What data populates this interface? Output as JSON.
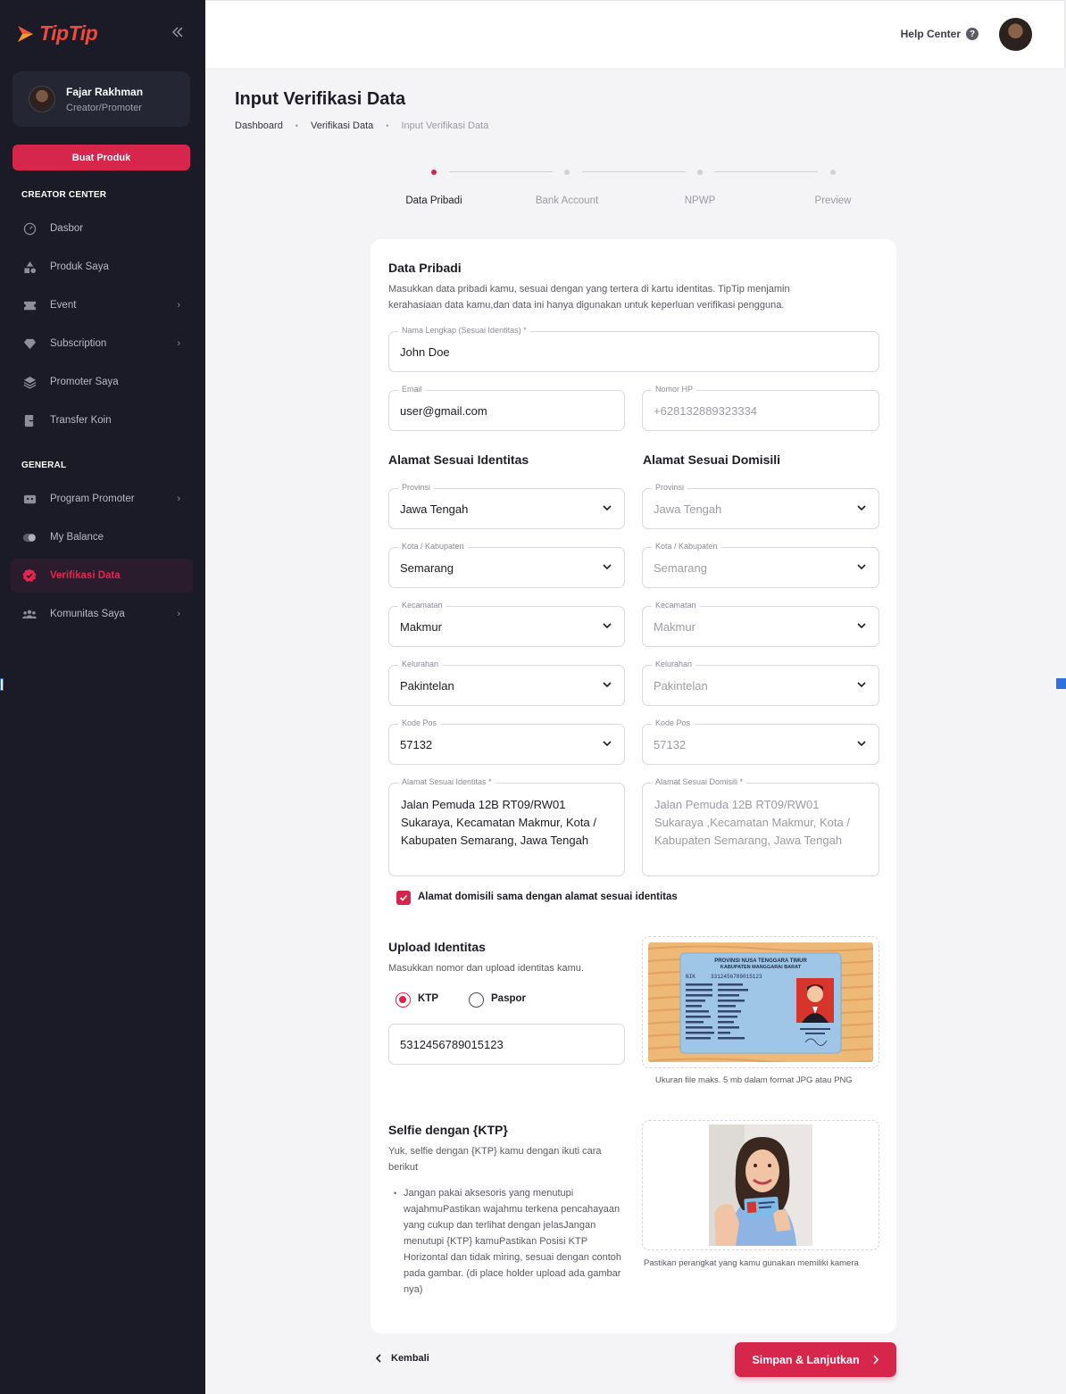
{
  "brand": {
    "name": "TipTip",
    "accent": "#d7264b",
    "sidebar_bg": "#1a1b27"
  },
  "sidebar": {
    "collapse_icon": "double-chevron-left-icon",
    "user": {
      "name": "Fajar Rakhman",
      "role": "Creator/Promoter"
    },
    "create_button": "Buat Produk",
    "sections": [
      {
        "title": "CREATOR CENTER"
      },
      {
        "title": "GENERAL"
      }
    ],
    "items": [
      {
        "label": "Dasbor",
        "icon": "gauge-icon"
      },
      {
        "label": "Produk Saya",
        "icon": "shapes-icon"
      },
      {
        "label": "Event",
        "icon": "ticket-icon"
      },
      {
        "label": "Subscription",
        "icon": "diamond-icon"
      },
      {
        "label": "Promoter Saya",
        "icon": "layers-icon"
      },
      {
        "label": "Transfer Koin",
        "icon": "transfer-icon"
      },
      {
        "label": "Program Promoter",
        "icon": "robot-icon"
      },
      {
        "label": "My Balance",
        "icon": "toggle-icon"
      },
      {
        "label": "Verifikasi Data",
        "icon": "verified-badge-icon"
      },
      {
        "label": "Komunitas Saya",
        "icon": "people-icon"
      }
    ]
  },
  "topbar": {
    "help": "Help Center",
    "help_icon": "question-circle-icon"
  },
  "page": {
    "title": "Input Verifikasi Data",
    "breadcrumb": [
      "Dashboard",
      "Verifikasi Data",
      "Input Verifikasi Data"
    ]
  },
  "stepper": {
    "steps": [
      "Data Pribadi",
      "Bank Account",
      "NPWP",
      "Preview"
    ],
    "active": 0
  },
  "form": {
    "title": "Data Pribadi",
    "description": "Masukkan data pribadi kamu, sesuai dengan yang tertera di kartu identitas. TipTip menjamin kerahasiaan data kamu,dan data ini hanya digunakan untuk keperluan verifikasi pengguna.",
    "full_name": {
      "label": "Nama Lengkap (Sesuai Identitas) *",
      "value": "John Doe"
    },
    "email": {
      "label": "Email",
      "value": "user@gmail.com"
    },
    "phone": {
      "label": "Nomor HP",
      "placeholder": "+628132889323334"
    },
    "identity_address": {
      "title": "Alamat Sesuai Identitas",
      "provinsi": {
        "label": "Provinsi",
        "value": "Jawa Tengah"
      },
      "kota": {
        "label": "Kota / Kabupaten",
        "value": "Semarang"
      },
      "kecamatan": {
        "label": "Kecamatan",
        "value": "Makmur"
      },
      "kelurahan": {
        "label": "Kelurahan",
        "value": "Pakintelan"
      },
      "kode_pos": {
        "label": "Kode Pos",
        "value": "57132"
      },
      "alamat": {
        "label": "Alamat Sesuai Identitas *",
        "value": "Jalan Pemuda 12B RT09/RW01 Sukaraya, Kecamatan Makmur, Kota / Kabupaten Semarang, Jawa Tengah"
      }
    },
    "domicile_address": {
      "title": "Alamat Sesuai Domisili",
      "provinsi": {
        "label": "Provinsi",
        "value": "Jawa Tengah"
      },
      "kota": {
        "label": "Kota / Kabupaten",
        "value": "Semarang"
      },
      "kecamatan": {
        "label": "Kecamatan",
        "value": "Makmur"
      },
      "kelurahan": {
        "label": "Kelurahan",
        "value": "Pakintelan"
      },
      "kode_pos": {
        "label": "Kode Pos",
        "value": "57132"
      },
      "alamat": {
        "label": "Alamat Sesuai Domisili *",
        "value": "Jalan Pemuda 12B RT09/RW01 Sukaraya ,Kecamatan Makmur, Kota / Kabupaten Semarang, Jawa Tengah"
      }
    },
    "same_address": {
      "label": "Alamat domisili sama dengan alamat sesuai identitas",
      "checked": true
    }
  },
  "upload": {
    "title": "Upload Identitas",
    "description": "Masukkan nomor dan upload identitas kamu.",
    "options": [
      "KTP",
      "Paspor"
    ],
    "selected": "KTP",
    "id_number": "5312456789015123",
    "caption": "Ukuran file maks. 5 mb dalam format JPG atau PNG",
    "ktp_card": {
      "header1": "PROVINSI NUSA TENGGARA TIMUR",
      "header2": "KABUPATEN MANGGARAI BARAT",
      "nik_label": "NIK",
      "nik": "3312456789015123"
    }
  },
  "selfie": {
    "title": "Selfie dengan {KTP}",
    "description": "Yuk, selfie dengan {KTP} kamu dengan ikuti cara berikut",
    "bullet": "Jangan pakai aksesoris yang menutupi wajahmuPastikan wajahmu terkena pencahayaan yang cukup dan terlihat dengan jelasJangan menutupi {KTP} kamuPastikan Posisi KTP Horizontal dan tidak miring, sesuai dengan contoh pada gambar. (di place holder upload ada gambar nya)",
    "caption": "Pastikan perangkat yang kamu gunakan memiliki kamera"
  },
  "actions": {
    "back": "Kembali",
    "next": "Simpan & Lanjutkan"
  }
}
